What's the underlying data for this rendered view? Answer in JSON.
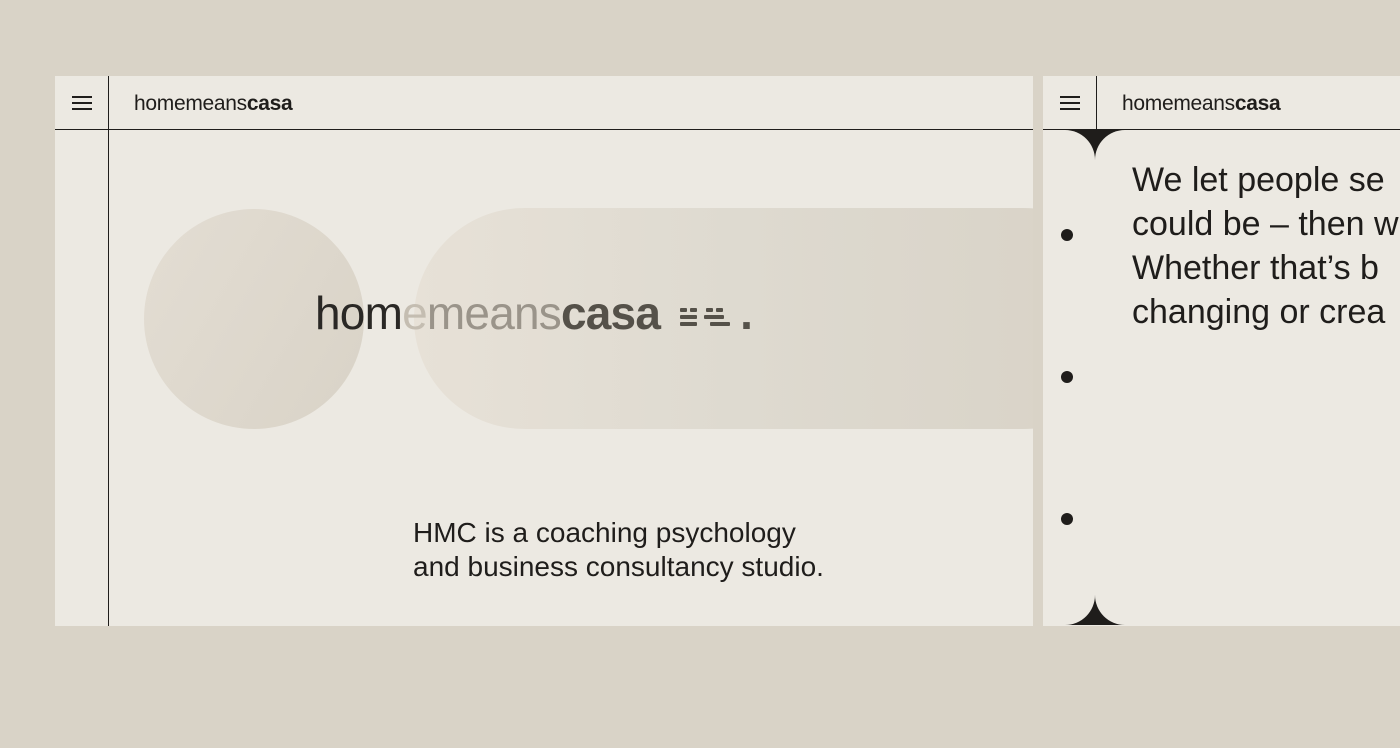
{
  "left_panel": {
    "header": {
      "brand_light": "home",
      "brand_mid": "means",
      "brand_bold": "casa",
      "menu_icon": "hamburger-menu-icon"
    },
    "hero": {
      "logo_a": "hom",
      "logo_b": "e",
      "logo_c": "means",
      "logo_d": "casa",
      "logo_suffix": ".",
      "logo_mark_icon": "dash-pattern-icon"
    },
    "tagline": {
      "line1": "HMC is a coaching psychology",
      "line2": "and business consultancy studio."
    }
  },
  "right_panel": {
    "header": {
      "brand_light": "home",
      "brand_mid": "means",
      "brand_bold": "casa",
      "menu_icon": "hamburger-menu-icon"
    },
    "statement": {
      "line1": "We let people se",
      "line2": "could be – then w",
      "line3": "Whether that’s b",
      "line4": "changing or crea"
    }
  },
  "colors": {
    "background": "#d9d3c7",
    "panel": "#ece9e2",
    "ink": "#1f1d1b"
  }
}
